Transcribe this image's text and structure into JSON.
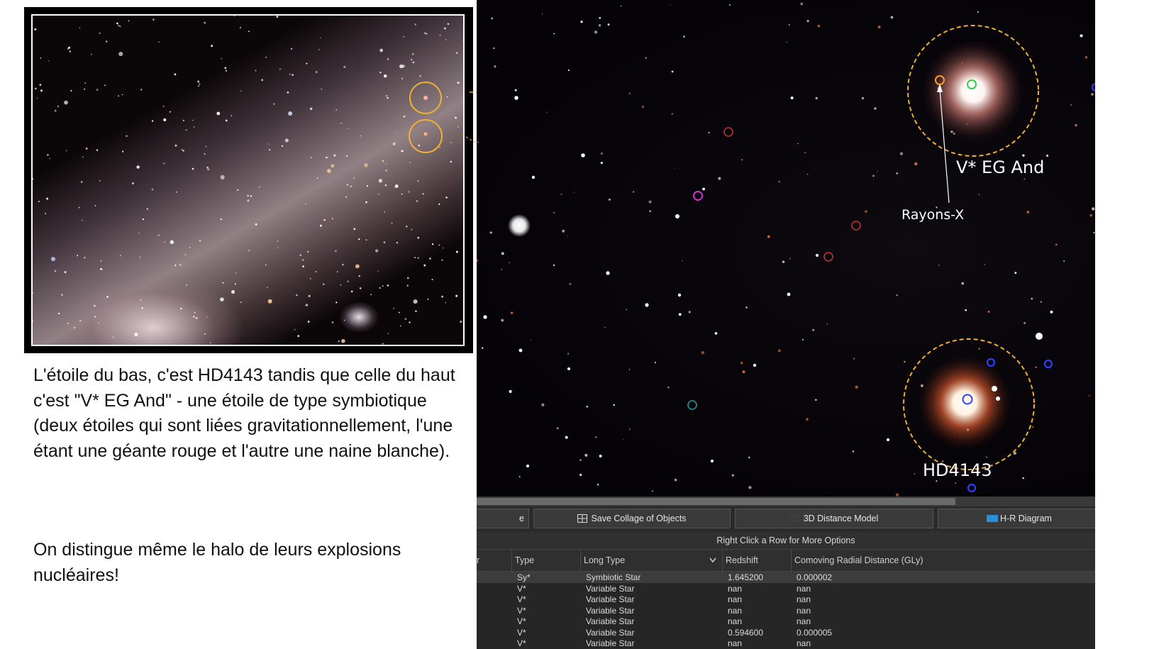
{
  "caption": {
    "paragraph1": "L'étoile du bas, c'est HD4143 tandis que celle du haut c'est \"V* EG And\" - une étoile de type symbiotique (deux étoiles qui sont liées gravitationnellement, l'une étant une géante rouge et l'autre une naine blanche).",
    "paragraph2": "On distingue même le halo de leurs explosions nucléaires!"
  },
  "sky_labels": {
    "eg_and": "V* EG And",
    "rayons_x": "Rayons-X",
    "hd4143": "HD4143"
  },
  "toolbar": {
    "partial_button": "e",
    "save_collage": "Save Collage of Objects",
    "distance_model": "3D Distance Model",
    "hr_diagram": "H-R Diagram"
  },
  "hint": "Right Click a Row for More Options",
  "table": {
    "columns": [
      "r",
      "Type",
      "Long Type",
      "Redshift",
      "Comoving Radial Distance (GLy)"
    ],
    "rows": [
      {
        "type": "Sy*",
        "long_type": "Symbiotic Star",
        "redshift": "1.645200",
        "distance": "0.000002"
      },
      {
        "type": "V*",
        "long_type": "Variable Star",
        "redshift": "nan",
        "distance": "nan"
      },
      {
        "type": "V*",
        "long_type": "Variable Star",
        "redshift": "nan",
        "distance": "nan"
      },
      {
        "type": "V*",
        "long_type": "Variable Star",
        "redshift": "nan",
        "distance": "nan"
      },
      {
        "type": "V*",
        "long_type": "Variable Star",
        "redshift": "nan",
        "distance": "nan"
      },
      {
        "type": "V*",
        "long_type": "Variable Star",
        "redshift": "0.594600",
        "distance": "0.000005"
      },
      {
        "type": "V*",
        "long_type": "Variable Star",
        "redshift": "nan",
        "distance": "nan"
      }
    ]
  },
  "colors": {
    "highlight_circle": "#f0b030",
    "marker_orange": "#ff9a20",
    "marker_green": "#30d050",
    "marker_blue": "#2840ff",
    "marker_red": "#c03a2a",
    "marker_magenta": "#d030d0",
    "marker_teal": "#20a0a0"
  }
}
